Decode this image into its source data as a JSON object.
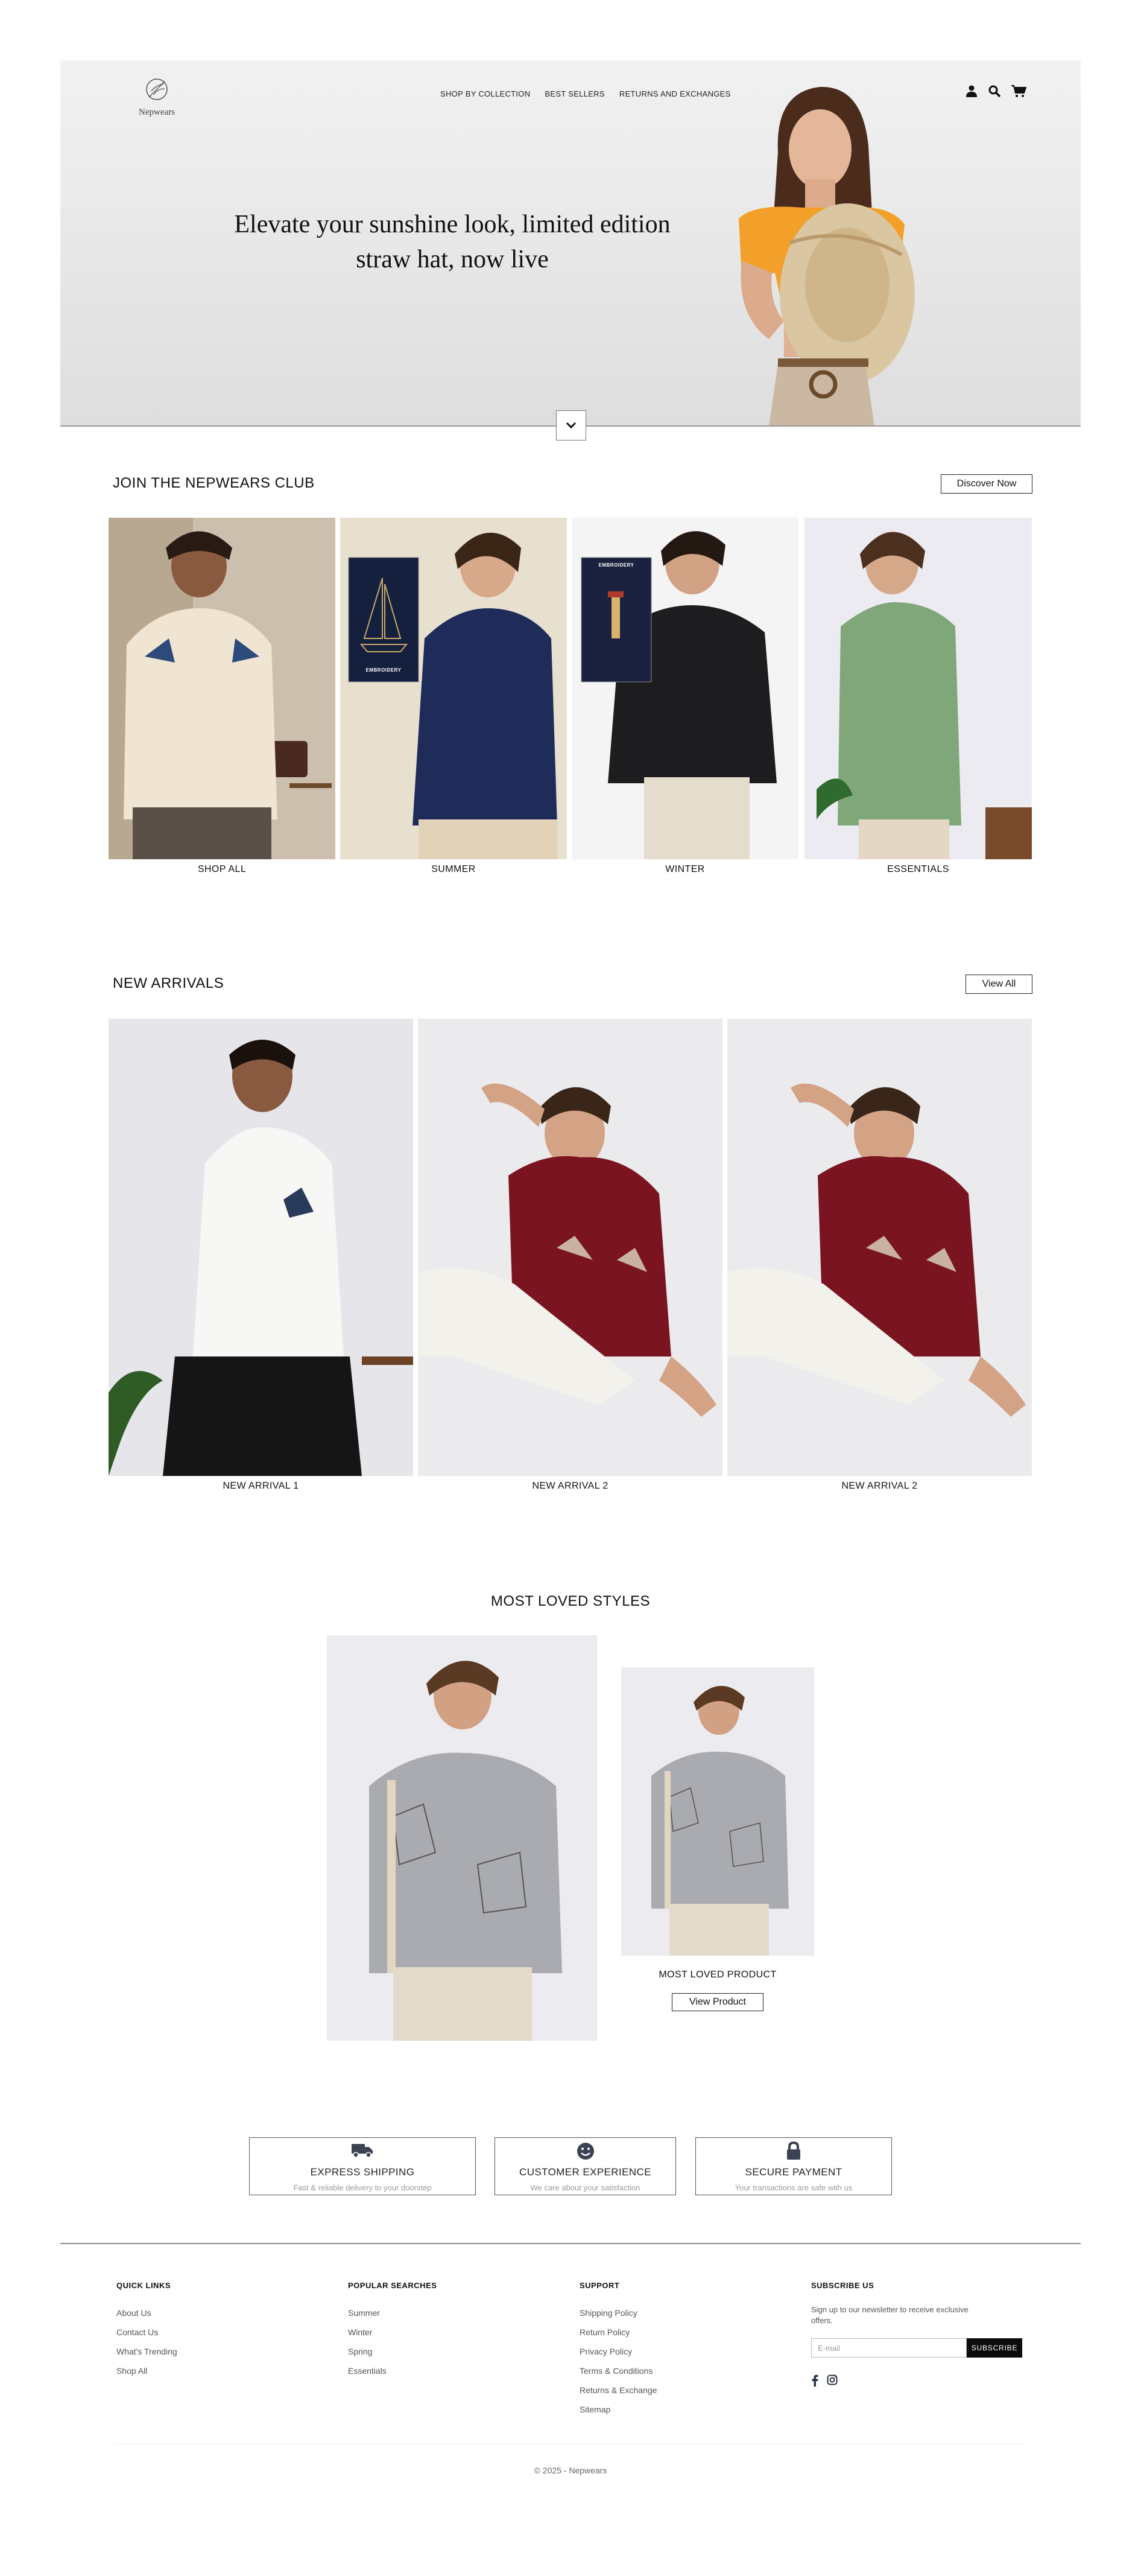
{
  "brand": {
    "name": "Nepwears"
  },
  "nav": {
    "items": [
      "SHOP BY COLLECTION",
      "BEST SELLERS",
      "RETURNS AND EXCHANGES"
    ]
  },
  "icons": {
    "user": "user-icon",
    "search": "search-icon",
    "cart": "cart-icon",
    "scroll": "chevron-down-icon"
  },
  "hero": {
    "line1": "Elevate your sunshine look, limited edition",
    "line2": "straw hat, now live"
  },
  "club": {
    "title": "JOIN THE NEPWEARS CLUB",
    "button": "Discover Now",
    "tiles": [
      {
        "label": "SHOP ALL",
        "tag": ""
      },
      {
        "label": "SUMMER",
        "tag": "EMBROIDERY"
      },
      {
        "label": "WINTER",
        "tag": "EMBROIDERY"
      },
      {
        "label": "ESSENTIALS",
        "tag": ""
      }
    ]
  },
  "arrivals": {
    "title": "NEW ARRIVALS",
    "button": "View All",
    "items": [
      "NEW ARRIVAL 1",
      "NEW ARRIVAL 2",
      "NEW ARRIVAL 2"
    ]
  },
  "loved": {
    "title": "MOST LOVED STYLES",
    "product": "MOST LOVED PRODUCT",
    "button": "View Product"
  },
  "features": [
    {
      "title": "EXPRESS SHIPPING",
      "sub": "Fast & reliable delivery to your doorstep",
      "icon": "truck-icon"
    },
    {
      "title": "CUSTOMER EXPERIENCE",
      "sub": "We care about your satisfaction",
      "icon": "smile-icon"
    },
    {
      "title": "SECURE PAYMENT",
      "sub": "Your transactions are safe with us",
      "icon": "lock-icon"
    }
  ],
  "footer": {
    "quick": {
      "title": "QUICK LINKS",
      "links": [
        "About Us",
        "Contact Us",
        "What's Trending",
        "Shop All"
      ]
    },
    "popular": {
      "title": "POPULAR SEARCHES",
      "links": [
        "Summer",
        "Winter",
        "Spring",
        "Essentials"
      ]
    },
    "support": {
      "title": "SUPPORT",
      "links": [
        "Shipping Policy",
        "Return Policy",
        "Privacy Policy",
        "Terms & Conditions",
        "Returns & Exchange",
        "Sitemap"
      ]
    },
    "subscribe": {
      "title": "SUBSCRIBE US",
      "text": "Sign up to our newsletter to receive exclusive offers.",
      "placeholder": "E-mail",
      "button": "SUBSCRIBE"
    },
    "social": [
      "facebook-icon",
      "instagram-icon"
    ],
    "copyright": "© 2025 - Nepwears"
  },
  "colors": {
    "accent": "#0c0c0c",
    "shirt_navy": "#1f2c5a",
    "shirt_black": "#1d1d1f",
    "shirt_green": "#7fa77a",
    "shirt_red": "#7a1420",
    "shirt_grey": "#a9abb0"
  }
}
